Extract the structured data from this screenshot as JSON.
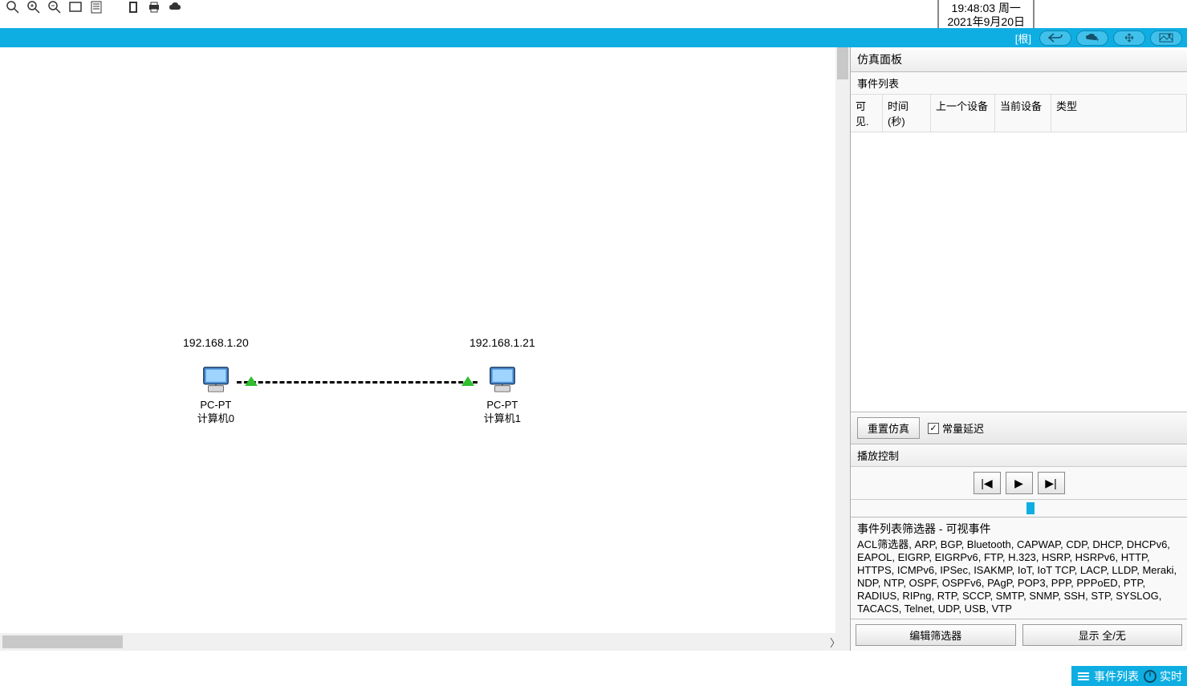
{
  "clock": {
    "time": "19:48:03",
    "weekday": "周一",
    "date": "2021年9月20日"
  },
  "bluebar": {
    "root_label": "[根]"
  },
  "topology": {
    "pc0": {
      "ip": "192.168.1.20",
      "type": "PC-PT",
      "name": "计算机0"
    },
    "pc1": {
      "ip": "192.168.1.21",
      "type": "PC-PT",
      "name": "计算机1"
    }
  },
  "panel": {
    "title": "仿真面板",
    "event_list_label": "事件列表",
    "cols": {
      "c1": "可见.",
      "c2": "时间(秒)",
      "c3": "上一个设备",
      "c4": "当前设备",
      "c5": "类型"
    },
    "reset_btn": "重置仿真",
    "const_delay_label": "常量延迟",
    "playback_label": "播放控制",
    "filter_title": "事件列表筛选器 - 可视事件",
    "filter_protocols": "ACL筛选器, ARP, BGP, Bluetooth, CAPWAP, CDP, DHCP, DHCPv6, EAPOL, EIGRP, EIGRPv6, FTP, H.323, HSRP, HSRPv6, HTTP, HTTPS, ICMPv6, IPSec, ISAKMP, IoT, IoT TCP, LACP, LLDP, Meraki, NDP, NTP, OSPF, OSPFv6, PAgP, POP3, PPP, PPPoED, PTP, RADIUS, RIPng, RTP, SCCP, SMTP, SNMP, SSH, STP, SYSLOG, TACACS, Telnet, UDP, USB, VTP",
    "edit_filter_btn": "编辑筛选器",
    "show_all_btn": "显示 全/无"
  },
  "bottombar": {
    "events": "事件列表",
    "realtime": "实时"
  }
}
